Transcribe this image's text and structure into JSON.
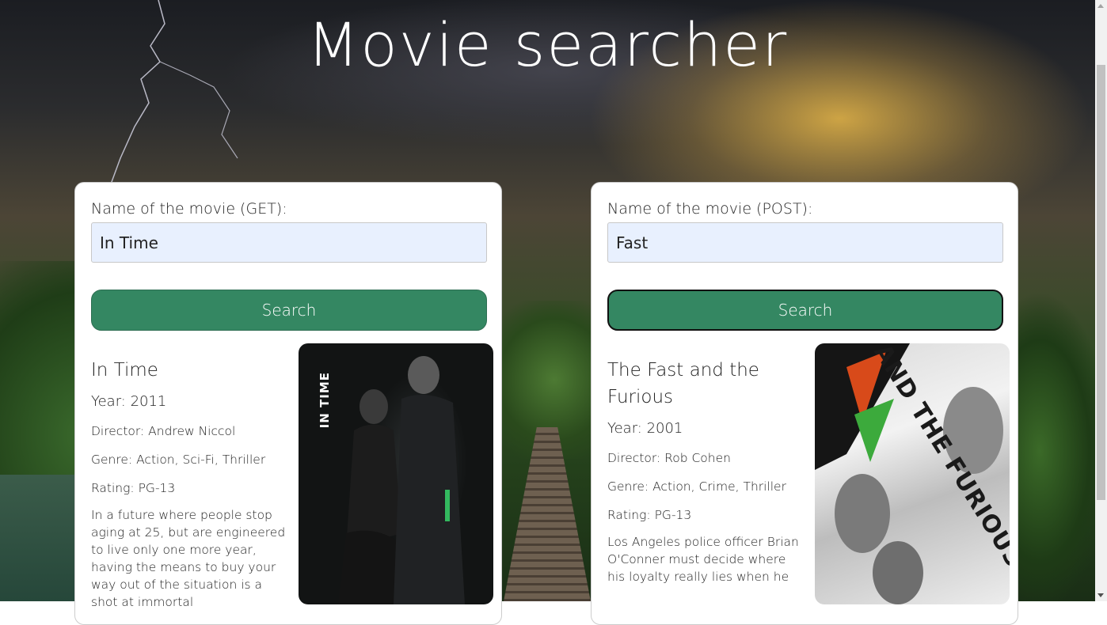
{
  "page": {
    "title": "Movie searcher"
  },
  "get_form": {
    "label": "Name of the movie (GET):",
    "value": "In Time",
    "button": "Search",
    "result": {
      "title": "In Time",
      "year": "Year: 2011",
      "director": "Director: Andrew Niccol",
      "genre": "Genre: Action, Sci-Fi, Thriller",
      "rating": "Rating: PG-13",
      "plot": "In a future where people stop aging at 25, but are engineered to live only one more year, having the means to buy your way out of the situation is a shot at immortal",
      "poster_text": "IN TIME"
    }
  },
  "post_form": {
    "label": "Name of the movie (POST):",
    "value": "Fast",
    "button": "Search",
    "result": {
      "title": "The Fast and the Furious",
      "year": "Year: 2001",
      "director": "Director: Rob Cohen",
      "genre": "Genre: Action, Crime, Thriller",
      "rating": "Rating: PG-13",
      "plot": "Los Angeles police officer Brian O'Conner must decide where his loyalty really lies when he",
      "poster_text": "THE FAST AND THE FURIOUS"
    }
  },
  "colors": {
    "button": "#348762",
    "input_bg": "#e8f0fe"
  }
}
